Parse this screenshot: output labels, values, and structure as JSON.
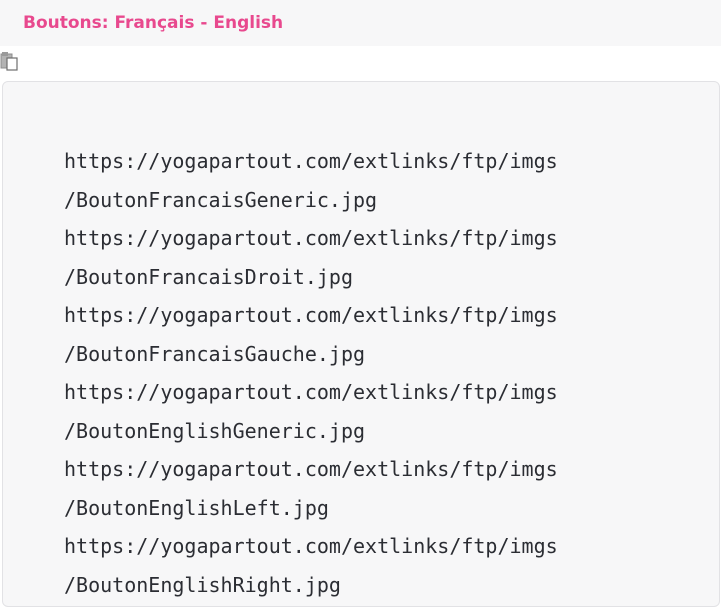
{
  "header": {
    "title": "Boutons: Français - English"
  },
  "colors": {
    "title": "#e8498e",
    "code_text": "#2b2d33",
    "background_panel": "#f7f7f8",
    "border": "#e2e2e5"
  },
  "copy_button": {
    "icon": "copy-icon"
  },
  "code": {
    "lines": [
      "https://yogapartout.com/extlinks/ftp/imgs",
      "/BoutonFrancaisGeneric.jpg",
      "https://yogapartout.com/extlinks/ftp/imgs",
      "/BoutonFrancaisDroit.jpg",
      "https://yogapartout.com/extlinks/ftp/imgs",
      "/BoutonFrancaisGauche.jpg",
      "https://yogapartout.com/extlinks/ftp/imgs",
      "/BoutonEnglishGeneric.jpg",
      "https://yogapartout.com/extlinks/ftp/imgs",
      "/BoutonEnglishLeft.jpg",
      "https://yogapartout.com/extlinks/ftp/imgs",
      "/BoutonEnglishRight.jpg"
    ]
  }
}
